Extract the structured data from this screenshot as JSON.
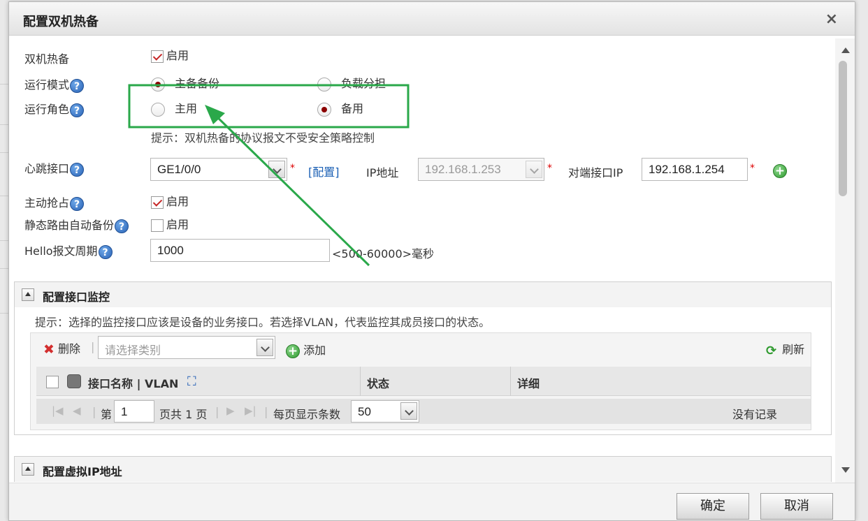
{
  "dialog": {
    "title": "配置双机热备",
    "close": "×"
  },
  "form": {
    "ha_label": "双机热备",
    "ha_enable": "启用",
    "mode_label": "运行模式",
    "mode_active_standby": "主备备份",
    "mode_load_share": "负载分担",
    "role_label": "运行角色",
    "role_active": "主用",
    "role_standby": "备用",
    "hint": "提示：双机热备的协议报文不受安全策略控制",
    "heartbeat_label": "心跳接口",
    "heartbeat_value": "GE1/0/0",
    "config_link": "[配置]",
    "ip_label": "IP地址",
    "ip_value": "192.168.1.253",
    "peer_ip_label": "对端接口IP",
    "peer_ip_value": "192.168.1.254",
    "required_mark": "*",
    "preempt_label": "主动抢占",
    "preempt_enable": "启用",
    "static_route_label": "静态路由自动备份",
    "static_route_enable": "启用",
    "hello_label": "Hello报文周期",
    "hello_value": "1000",
    "hello_range": "<500-60000>毫秒"
  },
  "monitor_panel": {
    "title": "配置接口监控",
    "hint": "提示：选择的监控接口应该是设备的业务接口。若选择VLAN，代表监控其成员接口的状态。",
    "delete": "删除",
    "category_placeholder": "请选择类别",
    "add": "添加",
    "refresh": "刷新",
    "columns": {
      "name": "接口名称 | VLAN",
      "status": "状态",
      "detail": "详细"
    },
    "pager": {
      "page_prefix": "第",
      "page_value": "1",
      "page_total": "页共 1 页",
      "per_page_label": "每页显示条数",
      "per_page_value": "50",
      "no_records": "没有记录"
    }
  },
  "vip_panel": {
    "title": "配置虚拟IP地址"
  },
  "footer": {
    "ok": "确定",
    "cancel": "取消"
  },
  "annotation": {
    "color": "#2aa84a"
  },
  "colors": {
    "link": "#1a5fb4",
    "required": "#dd0000",
    "radio_selected": "#8b0000"
  }
}
